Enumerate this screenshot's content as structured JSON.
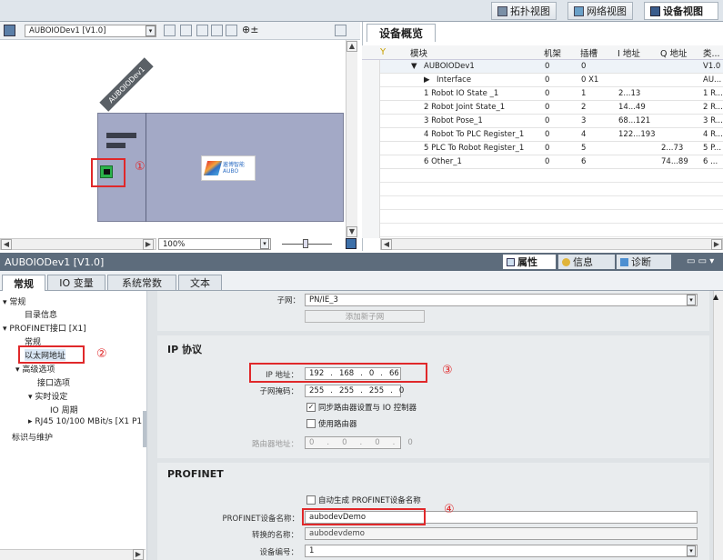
{
  "top_tabs": {
    "topology": "拓扑视图",
    "network": "网络视图",
    "device": "设备视图"
  },
  "toolbar": {
    "device_select": "AUBOIODev1 [V1.0]",
    "zoom": "100%"
  },
  "device_graphic": {
    "name": "AUBOIODev1",
    "logo_text": "遨博智能",
    "logo_sub": "AUBO"
  },
  "overview": {
    "title": "设备概览",
    "columns": [
      "模块",
      "机架",
      "插槽",
      "I 地址",
      "Q 地址",
      "类..."
    ],
    "rows": [
      {
        "module": "AUBOIODev1",
        "rack": "0",
        "slot": "0",
        "i": "",
        "q": "",
        "type": "V1.0"
      },
      {
        "module": "Interface",
        "rack": "0",
        "slot": "0 X1",
        "i": "",
        "q": "",
        "type": "AU..."
      },
      {
        "module": "1 Robot IO State _1",
        "rack": "0",
        "slot": "1",
        "i": "2...13",
        "q": "",
        "type": "1 R..."
      },
      {
        "module": "2 Robot Joint State_1",
        "rack": "0",
        "slot": "2",
        "i": "14...49",
        "q": "",
        "type": "2 R..."
      },
      {
        "module": "3 Robot Pose_1",
        "rack": "0",
        "slot": "3",
        "i": "68...121",
        "q": "",
        "type": "3 R..."
      },
      {
        "module": "4 Robot To PLC Register_1",
        "rack": "0",
        "slot": "4",
        "i": "122...193",
        "q": "",
        "type": "4 R..."
      },
      {
        "module": "5 PLC To Robot Register_1",
        "rack": "0",
        "slot": "5",
        "i": "",
        "q": "2...73",
        "type": "5 P..."
      },
      {
        "module": "6 Other_1",
        "rack": "0",
        "slot": "6",
        "i": "",
        "q": "74...89",
        "type": "6 ..."
      }
    ]
  },
  "props_header": {
    "title": "AUBOIODev1 [V1.0]",
    "tab_props": "属性",
    "tab_info": "信息",
    "tab_diag": "诊断"
  },
  "prop_tabs": [
    "常规",
    "IO 变量",
    "系统常数",
    "文本"
  ],
  "tree": {
    "general": "常规",
    "catalog": "目录信息",
    "profinet_if": "PROFINET接口 [X1]",
    "if_general": "常规",
    "ethernet": "以太网地址",
    "advanced": "高级选项",
    "if_options": "接口选项",
    "realtime": "实时设定",
    "io_cycle": "IO 周期",
    "rj45": "RJ45 10/100 MBit/s [X1 P1]",
    "ident": "标识与维护"
  },
  "form": {
    "subnet_label": "子网：",
    "subnet_value": "PN/IE_3",
    "add_subnet": "添加新子网",
    "ip_section": "IP 协议",
    "ip_label": "IP 地址：",
    "ip": [
      "192",
      "168",
      "0",
      "66"
    ],
    "mask_label": "子网掩码：",
    "mask": [
      "255",
      "255",
      "255",
      "0"
    ],
    "sync_router": "同步路由器设置与 IO 控制器",
    "use_router": "使用路由器",
    "router_label": "路由器地址：",
    "router": [
      "0",
      "0",
      "0",
      "0"
    ],
    "profinet_section": "PROFINET",
    "auto_name": "自动生成 PROFINET设备名称",
    "dev_name_label": "PROFINET设备名称：",
    "dev_name": "aubodevDemo",
    "converted_label": "转换的名称：",
    "converted": "aubodevdemo",
    "dev_num_label": "设备编号：",
    "dev_num": "1"
  },
  "annotations": [
    "①",
    "②",
    "③",
    "④"
  ],
  "colors": {
    "accent": "#e0282a",
    "header_bar": "#5d6c7c",
    "device_body": "#a3a9c6",
    "section_bg": "#e9ecee"
  }
}
